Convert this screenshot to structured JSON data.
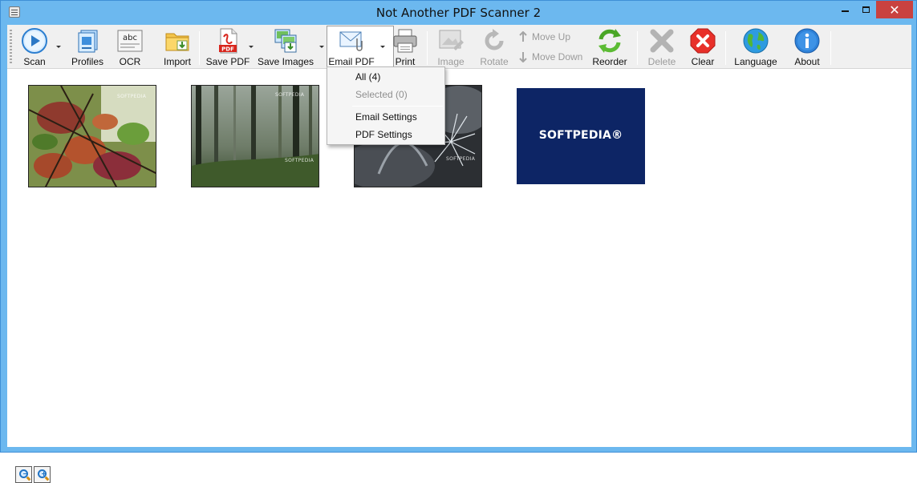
{
  "window": {
    "title": "Not Another PDF Scanner 2",
    "close_glyph": "✕"
  },
  "toolbar": {
    "scan": "Scan",
    "profiles": "Profiles",
    "ocr": "OCR",
    "ocr_icon_text": "abc",
    "import": "Import",
    "save_pdf": "Save PDF",
    "pdf_icon_text": "PDF",
    "save_images": "Save Images",
    "email_pdf": "Email PDF",
    "print": "Print",
    "image": "Image",
    "rotate": "Rotate",
    "move_up": "Move Up",
    "move_down": "Move Down",
    "reorder": "Reorder",
    "delete": "Delete",
    "clear": "Clear",
    "language": "Language",
    "about": "About"
  },
  "email_menu": {
    "all": "All (4)",
    "selected": "Selected (0)",
    "email_settings": "Email Settings",
    "pdf_settings": "PDF Settings"
  },
  "thumbnails": [
    {
      "label": "SOFTPEDIA",
      "theme": "autumn-leaves"
    },
    {
      "label": "SOFTPEDIA",
      "theme": "misty-forest"
    },
    {
      "label": "SOFTPEDIA",
      "theme": "frost-plant"
    },
    {
      "label": "SOFTPEDIA®",
      "theme": "logo"
    }
  ],
  "colors": {
    "titlebar": "#6cb8ef",
    "close": "#c94240",
    "toolbar": "#f0f0f0",
    "logo_bg": "#0d2565"
  }
}
